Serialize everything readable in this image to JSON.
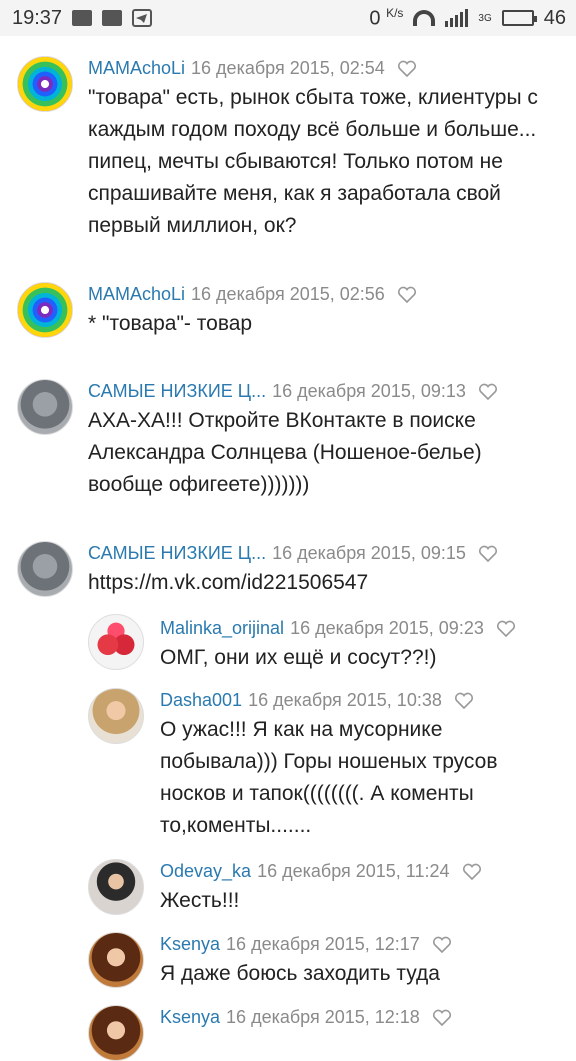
{
  "status_bar": {
    "time": "19:37",
    "speed_value": "0",
    "speed_unit": "K/s",
    "network": "3G",
    "battery": "46",
    "battery_level": 0.46
  },
  "comments": [
    {
      "author": "MAMAchoLi",
      "date": "16 декабря 2015, 02:54",
      "text": "\"товара\" есть, рынок сбыта тоже, клиентуры с каждым годом походу всё больше и больше... пипец, мечты сбываются! Только потом не спрашивайте меня, как я заработала свой первый миллион, ок?"
    },
    {
      "author": "MAMAchoLi",
      "date": "16 декабря 2015, 02:56",
      "text": "* \"товара\"- товар"
    },
    {
      "author": "САМЫЕ НИЗКИЕ Ц...",
      "date": "16 декабря 2015, 09:13",
      "text": "АХА-ХА!!! Откройте ВКонтакте в поиске Александра Солнцева (Ношеное-белье) вообще офигеете)))))))"
    },
    {
      "author": "САМЫЕ НИЗКИЕ Ц...",
      "date": "16 декабря 2015, 09:15",
      "text": "https://m.vk.com/id221506547"
    },
    {
      "author": "Malinka_orijinal",
      "date": "16 декабря 2015, 09:23",
      "text": "ОМГ, они их ещё и сосут??!)"
    },
    {
      "author": "Dasha001",
      "date": "16 декабря 2015, 10:38",
      "text": "О ужас!!! Я как на мусорнике побывала))) Горы ношеных трусов носков и тапок((((((((. А коменты то,коменты......."
    },
    {
      "author": "Odevay_ka",
      "date": "16 декабря 2015, 11:24",
      "text": "Жесть!!!"
    },
    {
      "author": "Ksenya",
      "date": "16 декабря 2015, 12:17",
      "text": "Я даже боюсь заходить туда"
    },
    {
      "author": "Ksenya",
      "date": "16 декабря 2015, 12:18",
      "text": ""
    }
  ]
}
